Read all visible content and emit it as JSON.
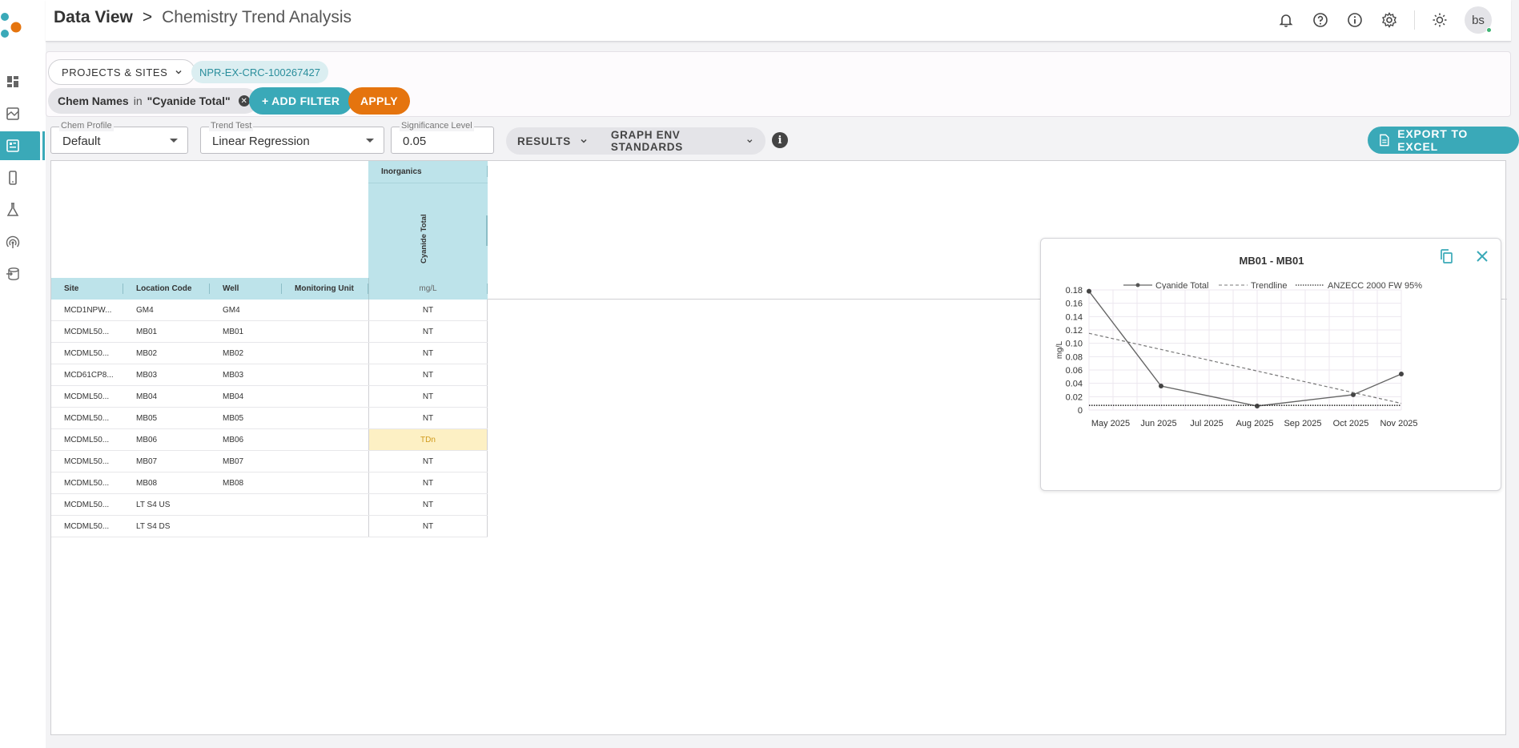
{
  "header": {
    "breadcrumb_root": "Data View",
    "breadcrumb_sep": ">",
    "page_title": "Chemistry Trend Analysis",
    "avatar_initials": "bs"
  },
  "filters": {
    "projects_label": "PROJECTS & SITES",
    "project_chip": "NPR-EX-CRC-100267427",
    "filter_field": "Chem Names",
    "filter_op": "in",
    "filter_value": "\"Cyanide Total\"",
    "add_filter_label": "+ ADD FILTER",
    "apply_label": "APPLY"
  },
  "controls": {
    "chem_profile": {
      "label": "Chem Profile",
      "value": "Default"
    },
    "trend_test": {
      "label": "Trend Test",
      "value": "Linear Regression"
    },
    "significance": {
      "label": "Significance Level",
      "value": "0.05"
    },
    "results_label": "RESULTS",
    "graph_env_label": "GRAPH ENV STANDARDS",
    "export_label": "EXPORT TO EXCEL"
  },
  "grid": {
    "group_header": "Inorganics",
    "vertical_column": "Cyanide Total",
    "columns": [
      "Site",
      "Location Code",
      "Well",
      "Monitoring Unit"
    ],
    "units": "mg/L",
    "rows": [
      {
        "site": "MCD1NPW...",
        "location": "GM4",
        "well": "GM4",
        "unit": "",
        "result": "NT"
      },
      {
        "site": "MCDML50...",
        "location": "MB01",
        "well": "MB01",
        "unit": "",
        "result": "NT"
      },
      {
        "site": "MCDML50...",
        "location": "MB02",
        "well": "MB02",
        "unit": "",
        "result": "NT"
      },
      {
        "site": "MCD61CP8...",
        "location": "MB03",
        "well": "MB03",
        "unit": "",
        "result": "NT"
      },
      {
        "site": "MCDML50...",
        "location": "MB04",
        "well": "MB04",
        "unit": "",
        "result": "NT"
      },
      {
        "site": "MCDML50...",
        "location": "MB05",
        "well": "MB05",
        "unit": "",
        "result": "NT"
      },
      {
        "site": "MCDML50...",
        "location": "MB06",
        "well": "MB06",
        "unit": "",
        "result": "TDn",
        "highlight": true
      },
      {
        "site": "MCDML50...",
        "location": "MB07",
        "well": "MB07",
        "unit": "",
        "result": "NT"
      },
      {
        "site": "MCDML50...",
        "location": "MB08",
        "well": "MB08",
        "unit": "",
        "result": "NT"
      },
      {
        "site": "MCDML50...",
        "location": "LT S4 US",
        "well": "",
        "unit": "",
        "result": "NT"
      },
      {
        "site": "MCDML50...",
        "location": "LT S4 DS",
        "well": "",
        "unit": "",
        "result": "NT"
      }
    ]
  },
  "chart_data": {
    "type": "line",
    "title": "MB01 - MB01",
    "ylabel": "mg/L",
    "ylim": [
      0,
      0.18
    ],
    "yticks": [
      0,
      0.02,
      0.04,
      0.06,
      0.08,
      0.1,
      0.12,
      0.14,
      0.16,
      0.18
    ],
    "ytick_labels": [
      "0",
      "0.02",
      "0.04",
      "0.06",
      "0.08",
      "0.10",
      "0.12",
      "0.14",
      "0.16",
      "0.18"
    ],
    "xlim": [
      0,
      6.5
    ],
    "xticks": [
      0.45,
      1.45,
      2.45,
      3.45,
      4.45,
      5.45,
      6.45
    ],
    "xtick_labels": [
      "May 2025",
      "Jun 2025",
      "Jul 2025",
      "Aug 2025",
      "Sep 2025",
      "Oct 2025",
      "Nov 2025"
    ],
    "grid": true,
    "legend_position": "top",
    "series": [
      {
        "name": "Cyanide Total",
        "style": "solid-markers",
        "color": "#666666",
        "x": [
          0,
          1.5,
          3.5,
          5.5,
          6.5
        ],
        "y": [
          0.178,
          0.036,
          0.006,
          0.023,
          0.054
        ]
      },
      {
        "name": "Trendline",
        "style": "dashed",
        "color": "#777777",
        "x": [
          0,
          6.5
        ],
        "y": [
          0.115,
          0.01
        ]
      },
      {
        "name": "ANZECC 2000 FW 95%",
        "style": "dotted",
        "color": "#333333",
        "x": [
          0,
          6.5
        ],
        "y": [
          0.007,
          0.007
        ]
      }
    ]
  },
  "colors": {
    "accent": "#3aa9b8",
    "apply": "#e5740e",
    "grid_header": "#bde3ea",
    "highlight": "#fdf0c4"
  }
}
